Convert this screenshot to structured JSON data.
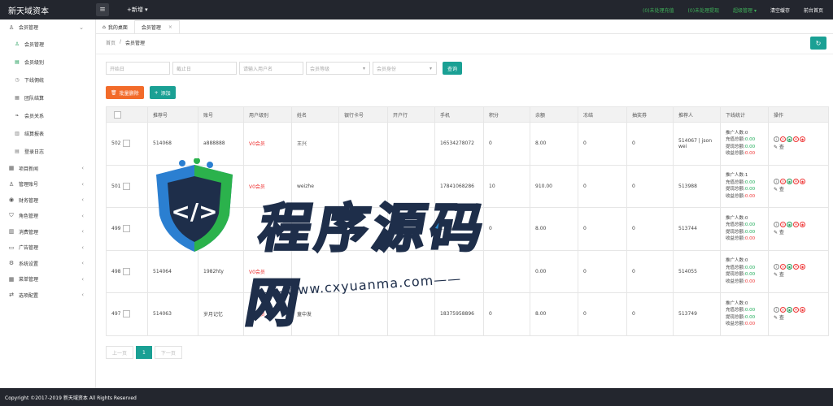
{
  "header": {
    "brand": "新天域资本",
    "menu_toggle_icon": "≡",
    "new_menu": "+新增 ▾",
    "right_links": [
      {
        "label": "(0)未处理充值",
        "style": "g"
      },
      {
        "label": "(0)未处理提现",
        "style": "g"
      },
      {
        "label": "超级管理 ▾",
        "style": "g"
      },
      {
        "label": "清空缓存",
        "style": "w"
      },
      {
        "label": "前台首页",
        "style": "w"
      }
    ]
  },
  "sidebar": {
    "groups": [
      {
        "label": "会员管理",
        "icon": "♙",
        "chev": "⌄",
        "expanded": true,
        "children": [
          {
            "label": "会员管理",
            "icon": "♙"
          },
          {
            "label": "会员级别",
            "icon": "▤"
          },
          {
            "label": "下线佣统",
            "icon": "◷"
          },
          {
            "label": "团队结算",
            "icon": "▦"
          },
          {
            "label": "会员关系",
            "icon": "❧"
          },
          {
            "label": "结算报表",
            "icon": "▥"
          },
          {
            "label": "登录日志",
            "icon": "▤"
          }
        ]
      },
      {
        "label": "项目新闻",
        "icon": "▦",
        "chev": "‹"
      },
      {
        "label": "管理账号",
        "icon": "♙",
        "chev": "‹"
      },
      {
        "label": "财务管理",
        "icon": "◉",
        "chev": "‹"
      },
      {
        "label": "角色管理",
        "icon": "⛉",
        "chev": "‹"
      },
      {
        "label": "消费管理",
        "icon": "▥",
        "chev": "‹"
      },
      {
        "label": "广告管理",
        "icon": "▭",
        "chev": "‹"
      },
      {
        "label": "系统设置",
        "icon": "⚙",
        "chev": "‹"
      },
      {
        "label": "菜单管理",
        "icon": "▦",
        "chev": "‹"
      },
      {
        "label": "选项配置",
        "icon": "⇄",
        "chev": "‹"
      }
    ]
  },
  "tabs": [
    {
      "label": "我的桌面",
      "icon": "⌂",
      "active": false
    },
    {
      "label": "会员管理",
      "icon": "",
      "active": true,
      "close": "×"
    }
  ],
  "breadcrumb": {
    "home": "首页",
    "sep": "/",
    "current": "会员管理"
  },
  "refresh_icon": "↻",
  "filters": {
    "start_date": "开始日",
    "end_date": "截止日",
    "username": "请输入用户名",
    "level": "会员等级",
    "identity": "会员身份",
    "query_button": "查询"
  },
  "actions": {
    "batch_delete": "批量删除",
    "batch_delete_icon": "🗑",
    "add": "添加",
    "add_icon": "+"
  },
  "table": {
    "headers": [
      "",
      "推荐号",
      "账号",
      "用户级别",
      "姓名",
      "银行卡号",
      "开户行",
      "手机",
      "积分",
      "余额",
      "冻结",
      "抽奖券",
      "推荐人",
      "下线统计",
      "操作"
    ],
    "stat_labels": [
      "推广人数:",
      "充值总额:",
      "提现总额:",
      "收益总额:"
    ],
    "edit_label": "✎ 查",
    "rows": [
      {
        "id": "502",
        "ref": "514068",
        "account": "a888888",
        "level": "V0会员",
        "name": "王兴",
        "card": "",
        "bank": "",
        "phone": "16534278072",
        "points": "0",
        "balance": "8.00",
        "frozen": "0",
        "tickets": "0",
        "referrer": "514067 | json wei",
        "stats": [
          "0",
          "0.00",
          "0.00",
          "0.00"
        ]
      },
      {
        "id": "501",
        "ref": "",
        "account": "",
        "level": "V0会员",
        "name": "weizhe",
        "card": "",
        "bank": "",
        "phone": "17841068286",
        "points": "10",
        "balance": "910.00",
        "frozen": "0",
        "tickets": "0",
        "referrer": "513988",
        "stats": [
          "1",
          "0.00",
          "0.00",
          "0.00"
        ]
      },
      {
        "id": "499",
        "ref": "",
        "account": "",
        "level": "",
        "name": "",
        "card": "",
        "bank": "",
        "phone": "13030318038",
        "points": "0",
        "balance": "8.00",
        "frozen": "0",
        "tickets": "0",
        "referrer": "513744",
        "stats": [
          "0",
          "0.00",
          "0.00",
          "0.00"
        ]
      },
      {
        "id": "498",
        "ref": "514064",
        "account": "1982hty",
        "level": "V0会员",
        "name": "",
        "card": "",
        "bank": "",
        "phone": "",
        "points": "",
        "balance": "0.00",
        "frozen": "0",
        "tickets": "0",
        "referrer": "514055",
        "stats": [
          "0",
          "0.00",
          "0.00",
          "0.00"
        ]
      },
      {
        "id": "497",
        "ref": "514063",
        "account": "岁月记忆",
        "level": "V0会员",
        "name": "童中发",
        "card": "",
        "bank": "",
        "phone": "18375958896",
        "points": "0",
        "balance": "8.00",
        "frozen": "0",
        "tickets": "0",
        "referrer": "513749",
        "stats": [
          "0",
          "0.00",
          "0.00",
          "0.00"
        ]
      }
    ]
  },
  "pagination": {
    "prev": "上一页",
    "current": "1",
    "next": "下一页"
  },
  "footer": "Copyright ©2017-2019 新天域资本 All Rights Reserved",
  "watermark": {
    "title_a": "程序",
    "title_b": "源码网",
    "url": "——www.cxyuanma.com——"
  },
  "colors": {
    "accent": "#1aa094",
    "header": "#23262e",
    "danger": "#f26b2a",
    "level": "#ee3333"
  }
}
